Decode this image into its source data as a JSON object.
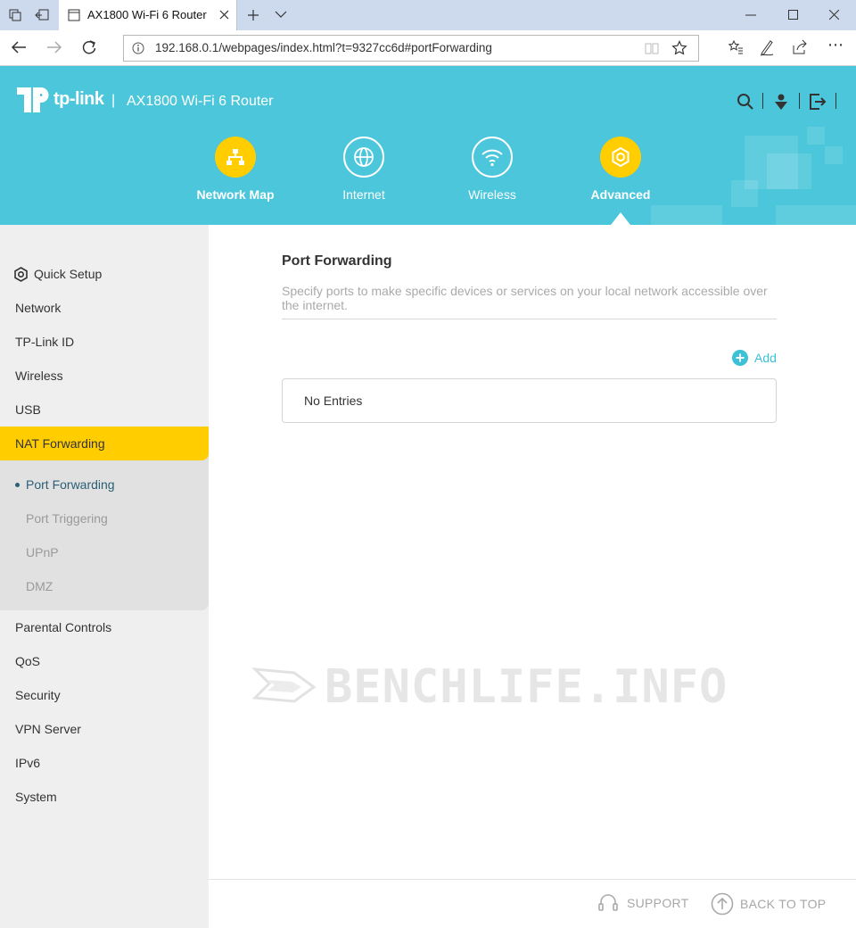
{
  "browser": {
    "tab_title": "AX1800 Wi-Fi 6 Router",
    "url": "192.168.0.1/webpages/index.html?t=9327cc6d#portForwarding"
  },
  "header": {
    "brand": "tp-link",
    "separator": "|",
    "model": "AX1800 Wi-Fi 6 Router",
    "nav": [
      {
        "label": "Network Map"
      },
      {
        "label": "Internet"
      },
      {
        "label": "Wireless"
      },
      {
        "label": "Advanced"
      }
    ]
  },
  "sidebar": {
    "items": [
      {
        "label": "Quick Setup"
      },
      {
        "label": "Network"
      },
      {
        "label": "TP-Link ID"
      },
      {
        "label": "Wireless"
      },
      {
        "label": "USB"
      },
      {
        "label": "NAT Forwarding"
      },
      {
        "label": "Parental Controls"
      },
      {
        "label": "QoS"
      },
      {
        "label": "Security"
      },
      {
        "label": "VPN Server"
      },
      {
        "label": "IPv6"
      },
      {
        "label": "System"
      }
    ],
    "subitems": [
      {
        "label": "Port Forwarding"
      },
      {
        "label": "Port Triggering"
      },
      {
        "label": "UPnP"
      },
      {
        "label": "DMZ"
      }
    ]
  },
  "main": {
    "title": "Port Forwarding",
    "description": "Specify ports to make specific devices or services on your local network accessible over the internet.",
    "add_label": "Add",
    "empty_text": "No Entries"
  },
  "watermark": "BENCHLIFE.INFO",
  "footer": {
    "support": "SUPPORT",
    "back_to_top": "BACK TO TOP"
  },
  "colors": {
    "header_bg": "#4bc6da",
    "accent_yellow": "#ffcd00",
    "teal": "#3cc1d6"
  }
}
